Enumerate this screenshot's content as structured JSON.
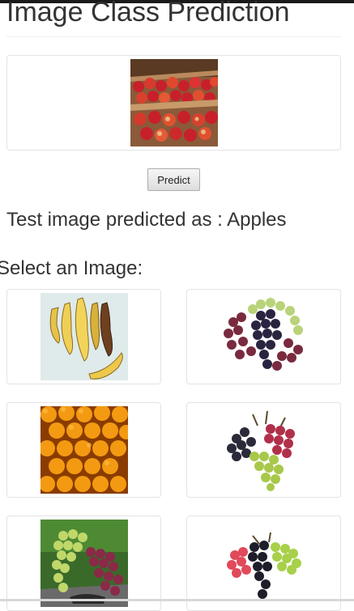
{
  "page": {
    "title": "Image Class Prediction"
  },
  "test_image": {
    "alt": "Test image: crates of red apples"
  },
  "controls": {
    "predict_label": "Predict"
  },
  "prediction": {
    "text": "Test image predicted as : Apples"
  },
  "gallery": {
    "heading": "Select an Image:",
    "items": [
      {
        "subject": "bananas"
      },
      {
        "subject": "grapes"
      },
      {
        "subject": "oranges"
      },
      {
        "subject": "grapes"
      },
      {
        "subject": "grapes"
      },
      {
        "subject": "grapes"
      }
    ]
  },
  "colors": {
    "text": "#333333",
    "card_border": "#e3e3e3",
    "button_bg": "#e8e8e8"
  }
}
